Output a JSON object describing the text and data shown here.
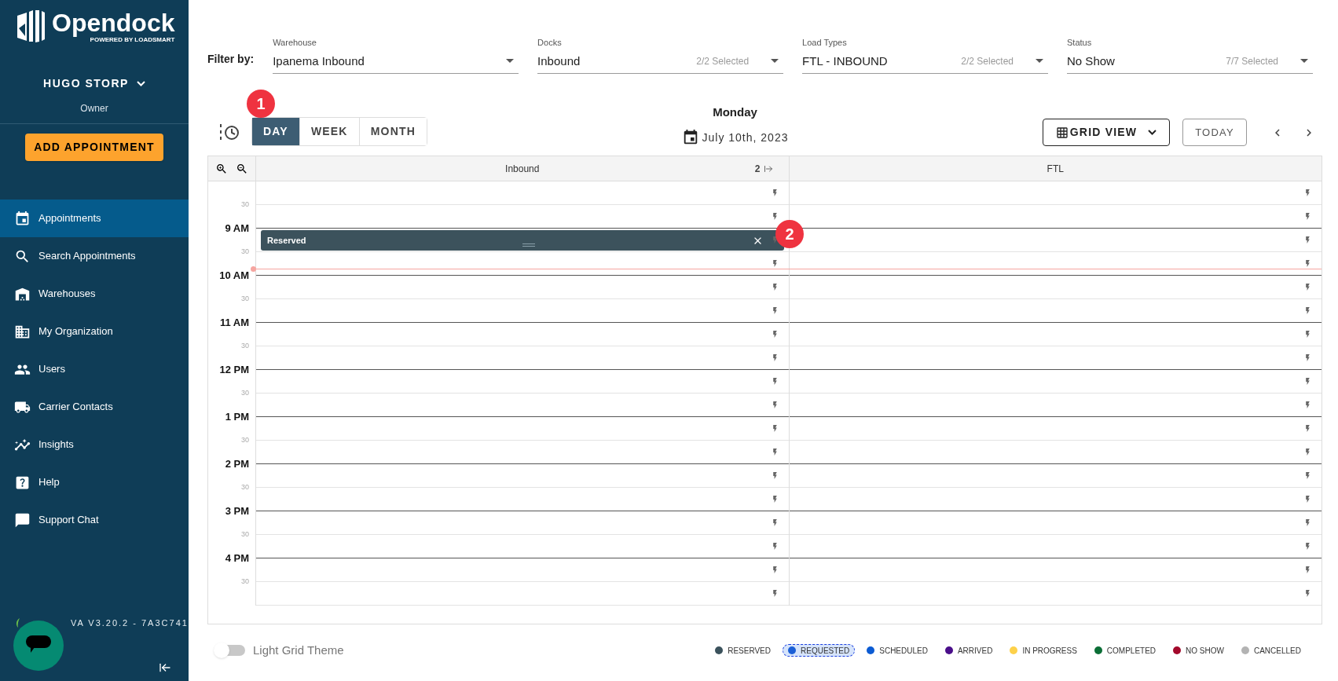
{
  "sidebar": {
    "brand": "Opendock",
    "brand_tagline": "POWERED BY LOADSMART",
    "user": {
      "name": "HUGO STORP",
      "role": "Owner"
    },
    "add_button": "ADD APPOINTMENT",
    "nav": [
      {
        "label": "Appointments",
        "selected": true
      },
      {
        "label": "Search Appointments",
        "selected": false
      },
      {
        "label": "Warehouses",
        "selected": false
      },
      {
        "label": "My Organization",
        "selected": false
      },
      {
        "label": "Users",
        "selected": false
      },
      {
        "label": "Carrier Contacts",
        "selected": false
      },
      {
        "label": "Insights",
        "selected": false
      },
      {
        "label": "Help",
        "selected": false
      },
      {
        "label": "Support Chat",
        "selected": false
      }
    ],
    "version": "VA V3.20.2 - 7A3C741"
  },
  "filters": {
    "label": "Filter by:",
    "fields": [
      {
        "label": "Warehouse",
        "value": "Ipanema Inbound"
      },
      {
        "label": "Docks",
        "value": "Inbound",
        "count": "2/2 Selected"
      },
      {
        "label": "Load Types",
        "value": "FTL - INBOUND",
        "count": "2/2 Selected"
      },
      {
        "label": "Status",
        "value": "No Show",
        "count": "7/7 Selected"
      }
    ]
  },
  "toolbar": {
    "views": [
      {
        "label": "DAY",
        "selected": true
      },
      {
        "label": "WEEK",
        "selected": false
      },
      {
        "label": "MONTH",
        "selected": false
      }
    ],
    "day": "Monday",
    "date": "July 10th, 2023",
    "grid_view": "GRID VIEW",
    "today": "TODAY"
  },
  "callouts": [
    "1",
    "2"
  ],
  "calendar": {
    "columns": [
      {
        "title": "Inbound",
        "count": "2",
        "events": [
          {
            "label": "Reserved"
          }
        ]
      },
      {
        "title": "FTL"
      }
    ],
    "time_labels": [
      {
        "text": "30",
        "kind": "half"
      },
      {
        "text": "9 AM",
        "kind": "hour"
      },
      {
        "text": "30",
        "kind": "half"
      },
      {
        "text": "10 AM",
        "kind": "hour"
      },
      {
        "text": "30",
        "kind": "half"
      },
      {
        "text": "11 AM",
        "kind": "hour"
      },
      {
        "text": "30",
        "kind": "half"
      },
      {
        "text": "12 PM",
        "kind": "hour"
      },
      {
        "text": "30",
        "kind": "half"
      },
      {
        "text": "1 PM",
        "kind": "hour"
      },
      {
        "text": "30",
        "kind": "half"
      },
      {
        "text": "2 PM",
        "kind": "hour"
      },
      {
        "text": "30",
        "kind": "half"
      },
      {
        "text": "3 PM",
        "kind": "hour"
      },
      {
        "text": "30",
        "kind": "half"
      },
      {
        "text": "4 PM",
        "kind": "hour"
      },
      {
        "text": "30",
        "kind": "half"
      }
    ]
  },
  "theme_toggle": {
    "label": "Light Grid Theme",
    "on": false
  },
  "legend": [
    {
      "label": "RESERVED",
      "color": "#3b525c",
      "selected": false
    },
    {
      "label": "REQUESTED",
      "color": "#1b5fd6",
      "selected": true
    },
    {
      "label": "SCHEDULED",
      "color": "#0b5bd3",
      "selected": false
    },
    {
      "label": "ARRIVED",
      "color": "#4a0e8a",
      "selected": false
    },
    {
      "label": "IN PROGRESS",
      "color": "#fdd14a",
      "selected": false
    },
    {
      "label": "COMPLETED",
      "color": "#0b6e36",
      "selected": false
    },
    {
      "label": "NO SHOW",
      "color": "#a3092b",
      "selected": false
    },
    {
      "label": "CANCELLED",
      "color": "#b3b3b3",
      "selected": false
    }
  ]
}
